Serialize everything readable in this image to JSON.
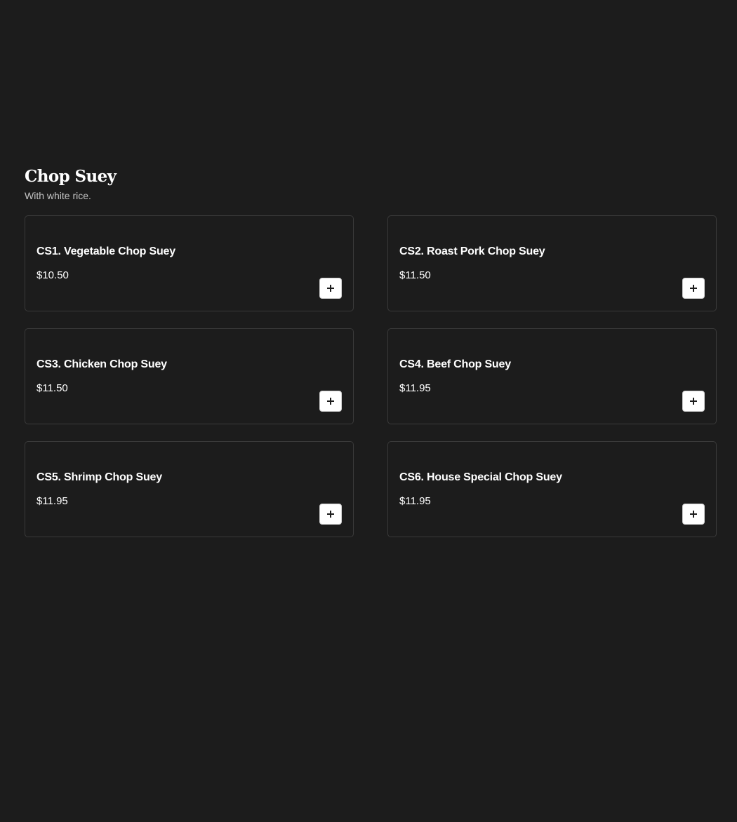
{
  "section": {
    "title": "Chop Suey",
    "subtitle": "With white rice."
  },
  "items": [
    {
      "name": "CS1. Vegetable Chop Suey",
      "price": "$10.50",
      "add_icon": "plus-icon"
    },
    {
      "name": "CS2. Roast Pork Chop Suey",
      "price": "$11.50",
      "add_icon": "plus-icon"
    },
    {
      "name": "CS3. Chicken Chop Suey",
      "price": "$11.50",
      "add_icon": "plus-icon"
    },
    {
      "name": "CS4. Beef Chop Suey",
      "price": "$11.95",
      "add_icon": "plus-icon"
    },
    {
      "name": "CS5. Shrimp Chop Suey",
      "price": "$11.95",
      "add_icon": "plus-icon"
    },
    {
      "name": "CS6. House Special Chop Suey",
      "price": "$11.95",
      "add_icon": "plus-icon"
    }
  ],
  "colors": {
    "background": "#1c1c1c",
    "card_border": "#3a3a3a",
    "text": "#ffffff",
    "subtext": "#c4c4c4",
    "button_bg": "#ffffff"
  }
}
